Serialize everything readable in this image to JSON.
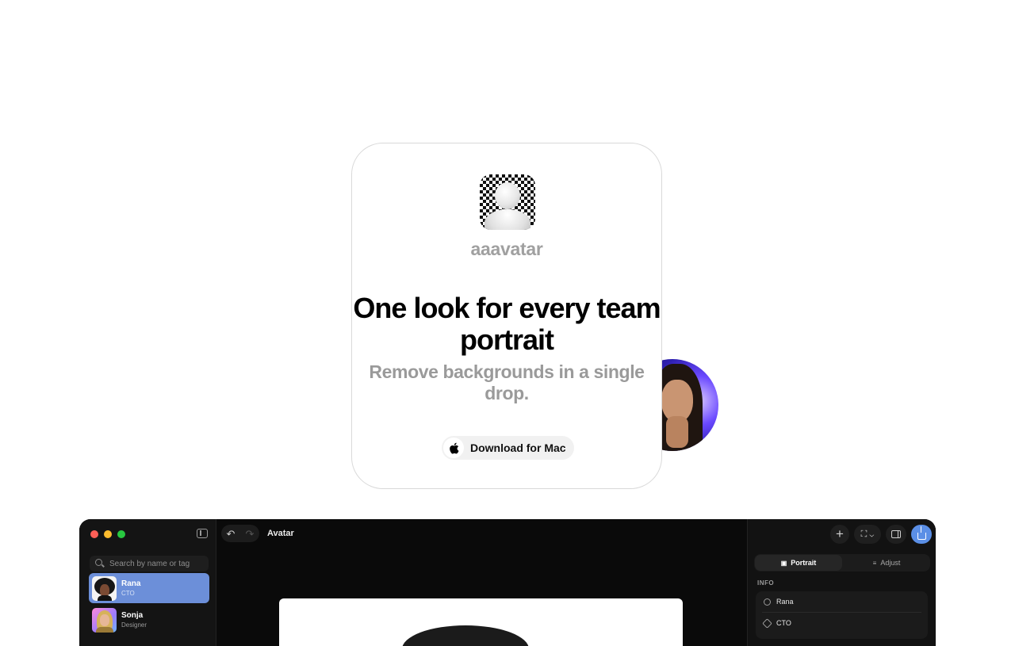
{
  "hero": {
    "brand": "aaavatar",
    "headline": "One look for every team portrait",
    "subheadline": "Remove backgrounds in a single drop.",
    "cta_label": "Download for Mac"
  },
  "app": {
    "title": "Avatar",
    "search_placeholder": "Search by name or tag",
    "people": [
      {
        "name": "Rana",
        "role": "CTO",
        "selected": true
      },
      {
        "name": "Sonja",
        "role": "Designer",
        "selected": false
      }
    ],
    "tabs": [
      {
        "label": "Portrait",
        "icon": "portrait-icon",
        "active": true
      },
      {
        "label": "Adjust",
        "icon": "sliders-icon",
        "active": false
      }
    ],
    "info_section_label": "INFO",
    "info_fields": [
      {
        "value": "Rana",
        "icon": "person-icon"
      },
      {
        "value": "CTO",
        "icon": "tag-icon"
      }
    ],
    "colors": {
      "accent": "#6c8fd9",
      "share_button": "#5b8fe6",
      "traffic_red": "#ff5f57",
      "traffic_yellow": "#febc2e",
      "traffic_green": "#28c840"
    }
  }
}
